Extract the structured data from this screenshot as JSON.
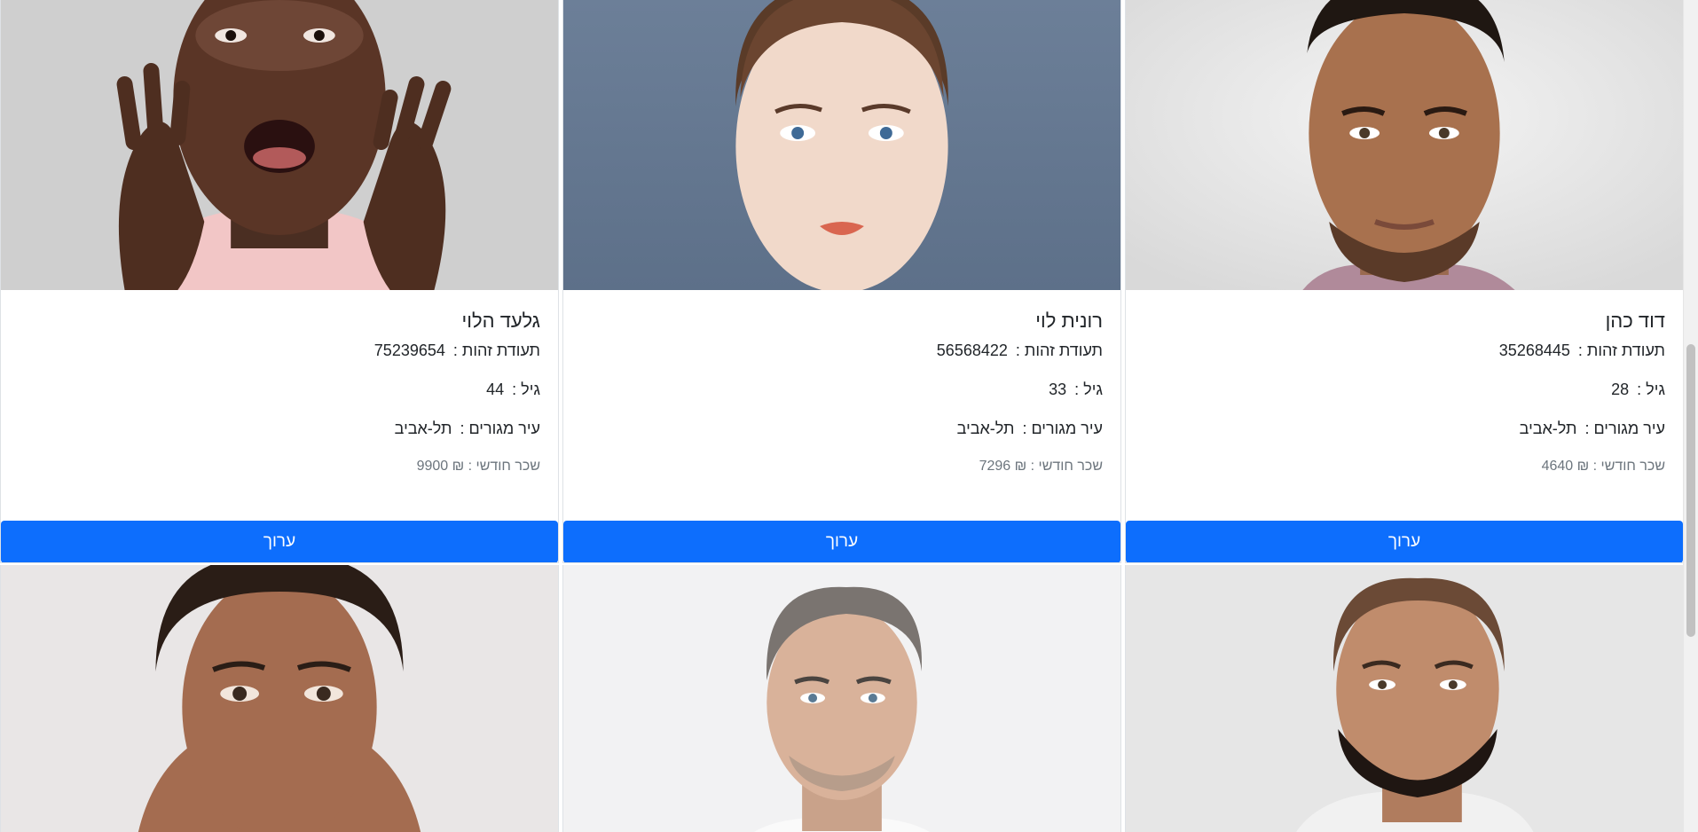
{
  "cards_row1": [
    {
      "name": "דוד כהן",
      "id_label": "תעודת זהות :",
      "id_value": "35268445",
      "age_label": "גיל :",
      "age_value": "28",
      "city_label": "עיר מגורים :",
      "city_value": "תל-אביב",
      "salary_label": "שכר חודשי :",
      "salary_value": "₪ 4640",
      "edit_label": "ערוך"
    },
    {
      "name": "רונית לוי",
      "id_label": "תעודת זהות :",
      "id_value": "56568422",
      "age_label": "גיל :",
      "age_value": "33",
      "city_label": "עיר מגורים :",
      "city_value": "תל-אביב",
      "salary_label": "שכר חודשי :",
      "salary_value": "₪ 7296",
      "edit_label": "ערוך"
    },
    {
      "name": "גלעד הלוי",
      "id_label": "תעודת זהות :",
      "id_value": "75239654",
      "age_label": "גיל :",
      "age_value": "44",
      "city_label": "עיר מגורים :",
      "city_value": "תל-אביב",
      "salary_label": "שכר חודשי :",
      "salary_value": "₪ 9900",
      "edit_label": "ערוך"
    }
  ],
  "colors": {
    "primary_button": "#0d6efd",
    "muted_text": "#6c757d",
    "text": "#212529"
  }
}
